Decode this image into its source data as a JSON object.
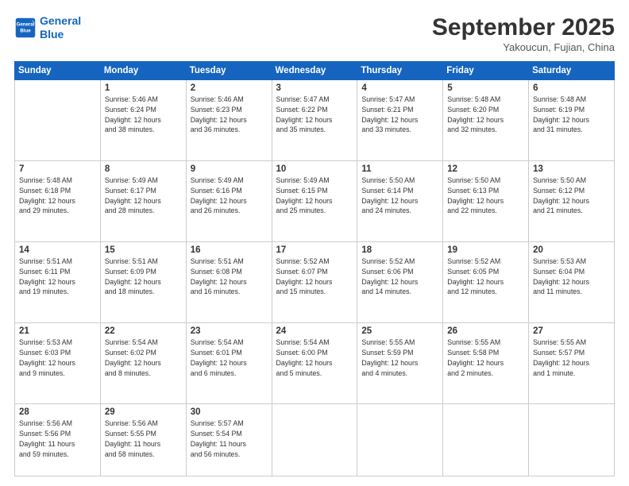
{
  "logo": {
    "line1": "General",
    "line2": "Blue"
  },
  "header": {
    "month": "September 2025",
    "location": "Yakoucun, Fujian, China"
  },
  "days": [
    "Sunday",
    "Monday",
    "Tuesday",
    "Wednesday",
    "Thursday",
    "Friday",
    "Saturday"
  ],
  "weeks": [
    [
      {
        "day": null,
        "info": null
      },
      {
        "day": "1",
        "info": "Sunrise: 5:46 AM\nSunset: 6:24 PM\nDaylight: 12 hours\nand 38 minutes."
      },
      {
        "day": "2",
        "info": "Sunrise: 5:46 AM\nSunset: 6:23 PM\nDaylight: 12 hours\nand 36 minutes."
      },
      {
        "day": "3",
        "info": "Sunrise: 5:47 AM\nSunset: 6:22 PM\nDaylight: 12 hours\nand 35 minutes."
      },
      {
        "day": "4",
        "info": "Sunrise: 5:47 AM\nSunset: 6:21 PM\nDaylight: 12 hours\nand 33 minutes."
      },
      {
        "day": "5",
        "info": "Sunrise: 5:48 AM\nSunset: 6:20 PM\nDaylight: 12 hours\nand 32 minutes."
      },
      {
        "day": "6",
        "info": "Sunrise: 5:48 AM\nSunset: 6:19 PM\nDaylight: 12 hours\nand 31 minutes."
      }
    ],
    [
      {
        "day": "7",
        "info": "Sunrise: 5:48 AM\nSunset: 6:18 PM\nDaylight: 12 hours\nand 29 minutes."
      },
      {
        "day": "8",
        "info": "Sunrise: 5:49 AM\nSunset: 6:17 PM\nDaylight: 12 hours\nand 28 minutes."
      },
      {
        "day": "9",
        "info": "Sunrise: 5:49 AM\nSunset: 6:16 PM\nDaylight: 12 hours\nand 26 minutes."
      },
      {
        "day": "10",
        "info": "Sunrise: 5:49 AM\nSunset: 6:15 PM\nDaylight: 12 hours\nand 25 minutes."
      },
      {
        "day": "11",
        "info": "Sunrise: 5:50 AM\nSunset: 6:14 PM\nDaylight: 12 hours\nand 24 minutes."
      },
      {
        "day": "12",
        "info": "Sunrise: 5:50 AM\nSunset: 6:13 PM\nDaylight: 12 hours\nand 22 minutes."
      },
      {
        "day": "13",
        "info": "Sunrise: 5:50 AM\nSunset: 6:12 PM\nDaylight: 12 hours\nand 21 minutes."
      }
    ],
    [
      {
        "day": "14",
        "info": "Sunrise: 5:51 AM\nSunset: 6:11 PM\nDaylight: 12 hours\nand 19 minutes."
      },
      {
        "day": "15",
        "info": "Sunrise: 5:51 AM\nSunset: 6:09 PM\nDaylight: 12 hours\nand 18 minutes."
      },
      {
        "day": "16",
        "info": "Sunrise: 5:51 AM\nSunset: 6:08 PM\nDaylight: 12 hours\nand 16 minutes."
      },
      {
        "day": "17",
        "info": "Sunrise: 5:52 AM\nSunset: 6:07 PM\nDaylight: 12 hours\nand 15 minutes."
      },
      {
        "day": "18",
        "info": "Sunrise: 5:52 AM\nSunset: 6:06 PM\nDaylight: 12 hours\nand 14 minutes."
      },
      {
        "day": "19",
        "info": "Sunrise: 5:52 AM\nSunset: 6:05 PM\nDaylight: 12 hours\nand 12 minutes."
      },
      {
        "day": "20",
        "info": "Sunrise: 5:53 AM\nSunset: 6:04 PM\nDaylight: 12 hours\nand 11 minutes."
      }
    ],
    [
      {
        "day": "21",
        "info": "Sunrise: 5:53 AM\nSunset: 6:03 PM\nDaylight: 12 hours\nand 9 minutes."
      },
      {
        "day": "22",
        "info": "Sunrise: 5:54 AM\nSunset: 6:02 PM\nDaylight: 12 hours\nand 8 minutes."
      },
      {
        "day": "23",
        "info": "Sunrise: 5:54 AM\nSunset: 6:01 PM\nDaylight: 12 hours\nand 6 minutes."
      },
      {
        "day": "24",
        "info": "Sunrise: 5:54 AM\nSunset: 6:00 PM\nDaylight: 12 hours\nand 5 minutes."
      },
      {
        "day": "25",
        "info": "Sunrise: 5:55 AM\nSunset: 5:59 PM\nDaylight: 12 hours\nand 4 minutes."
      },
      {
        "day": "26",
        "info": "Sunrise: 5:55 AM\nSunset: 5:58 PM\nDaylight: 12 hours\nand 2 minutes."
      },
      {
        "day": "27",
        "info": "Sunrise: 5:55 AM\nSunset: 5:57 PM\nDaylight: 12 hours\nand 1 minute."
      }
    ],
    [
      {
        "day": "28",
        "info": "Sunrise: 5:56 AM\nSunset: 5:56 PM\nDaylight: 11 hours\nand 59 minutes."
      },
      {
        "day": "29",
        "info": "Sunrise: 5:56 AM\nSunset: 5:55 PM\nDaylight: 11 hours\nand 58 minutes."
      },
      {
        "day": "30",
        "info": "Sunrise: 5:57 AM\nSunset: 5:54 PM\nDaylight: 11 hours\nand 56 minutes."
      },
      {
        "day": null,
        "info": null
      },
      {
        "day": null,
        "info": null
      },
      {
        "day": null,
        "info": null
      },
      {
        "day": null,
        "info": null
      }
    ]
  ]
}
